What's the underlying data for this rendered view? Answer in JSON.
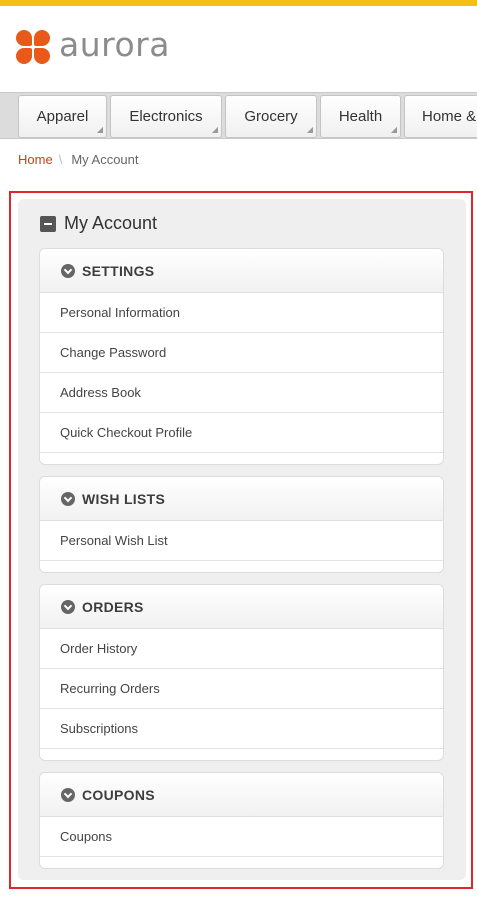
{
  "colors": {
    "stripe": "#f5be17",
    "logo": "#e8591a",
    "breadcrumb_home": "#c1441a",
    "focus_outline": "#e0262c"
  },
  "brand": {
    "name": "aurora",
    "logo_icon": "flower-logo-icon"
  },
  "nav": {
    "tabs": [
      {
        "label": "Apparel"
      },
      {
        "label": "Electronics"
      },
      {
        "label": "Grocery"
      },
      {
        "label": "Health"
      },
      {
        "label": "Home &"
      }
    ]
  },
  "breadcrumb": {
    "home": "Home",
    "separator": "\\",
    "current": "My Account"
  },
  "account": {
    "title": "My Account",
    "sections": [
      {
        "title": "SETTINGS",
        "links": [
          "Personal Information",
          "Change Password",
          "Address Book",
          "Quick Checkout Profile"
        ]
      },
      {
        "title": "WISH LISTS",
        "links": [
          "Personal Wish List"
        ]
      },
      {
        "title": "ORDERS",
        "links": [
          "Order History",
          "Recurring Orders",
          "Subscriptions"
        ]
      },
      {
        "title": "COUPONS",
        "links": [
          "Coupons"
        ]
      }
    ]
  }
}
